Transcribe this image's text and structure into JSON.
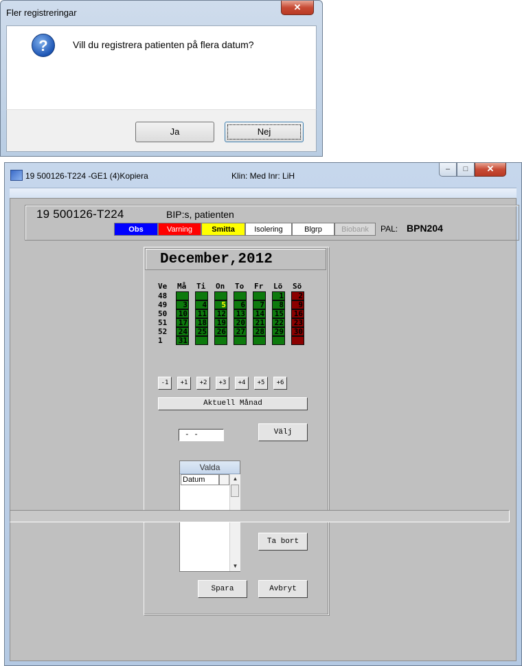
{
  "dialog": {
    "title": "Fler registreringar",
    "close": "✕",
    "icon": "question-icon",
    "message": "Vill du registrera patienten på flera datum?",
    "yes": "Ja",
    "no": "Nej"
  },
  "window": {
    "title": "19 500126-T224   -GE1 (4)Kopiera",
    "klin": "Klin: Med  Inr: LiH",
    "close": "✕",
    "min": "–",
    "max": "□"
  },
  "patient": {
    "pnr": "19 500126-T224",
    "name": "BIP:s, patienten",
    "flags": {
      "obs": "Obs",
      "varning": "Varning",
      "smitta": "Smitta",
      "isolering": "Isolering",
      "blgrp": "Blgrp",
      "biobank": "Biobank"
    },
    "pal_label": "PAL:",
    "pal_value": "BPN204"
  },
  "calendar": {
    "month": "December,2012",
    "headers": [
      "Ve",
      "Må",
      "Ti",
      "On",
      "To",
      "Fr",
      "Lö",
      "Sö"
    ],
    "weeks": [
      {
        "week": "48",
        "days": [
          "",
          "",
          "",
          "",
          "",
          "1",
          "2"
        ]
      },
      {
        "week": "49",
        "days": [
          "3",
          "4",
          "5",
          "6",
          "7",
          "8",
          "9"
        ]
      },
      {
        "week": "50",
        "days": [
          "10",
          "11",
          "12",
          "13",
          "14",
          "15",
          "16"
        ]
      },
      {
        "week": "51",
        "days": [
          "17",
          "18",
          "19",
          "20",
          "21",
          "22",
          "23"
        ]
      },
      {
        "week": "52",
        "days": [
          "24",
          "25",
          "26",
          "27",
          "28",
          "29",
          "30"
        ]
      },
      {
        "week": "1",
        "days": [
          "31",
          "",
          "",
          "",
          "",
          "",
          ""
        ]
      }
    ],
    "today": "5",
    "colors": {
      "weekday": "#0d7a0d",
      "weekend": "#8b0000",
      "today_text": "#ffff00"
    },
    "nav": [
      "-1",
      "+1",
      "+2",
      "+3",
      "+4",
      "+5",
      "+6"
    ],
    "current_month": "Aktuell Månad",
    "date_value": "-  -",
    "select": "Välj",
    "valda_header": "Valda",
    "valda_col": "Datum",
    "remove": "Ta bort",
    "save": "Spara",
    "cancel": "Avbryt"
  }
}
